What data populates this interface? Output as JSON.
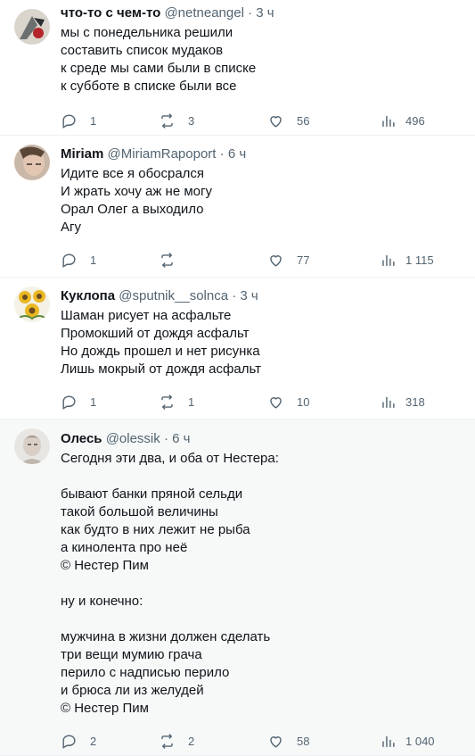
{
  "tweets": [
    {
      "name": "что-то с чем-то",
      "handle": "@netneangel",
      "time": "3 ч",
      "text": "мы с понедельника решили\nсоставить список мудаков\nк среде мы сами были в списке\nк субботе в списке были все",
      "replies": "1",
      "retweets": "3",
      "likes": "56",
      "views": "496"
    },
    {
      "name": "Miriam",
      "handle": "@MiriamRapoport",
      "time": "6 ч",
      "text": "Идите все я обосрался\nИ жрать хочу аж не могу\nОрал Олег а выходило\nАгу",
      "replies": "1",
      "retweets": "",
      "likes": "77",
      "views": "1 115"
    },
    {
      "name": "Куклопа",
      "handle": "@sputnik__solnca",
      "time": "3 ч",
      "text": "Шаман рисует на асфальте\nПромокший от дождя асфальт\nНо дождь прошел и нет рисунка\nЛишь мокрый от дождя асфальт",
      "replies": "1",
      "retweets": "1",
      "likes": "10",
      "views": "318"
    },
    {
      "name": "Олесь",
      "handle": "@olessik",
      "time": "6 ч",
      "text": "Сегодня эти два, и оба от Нестера:\n\nбывают банки пряной сельди\nтакой большой величины\nкак будто в них лежит не рыба\nа кинолента про неё\n© Нестер Пим\n\nну и конечно:\n\nмужчина в жизни должен сделать\nтри вещи мумию грача\nперило с надписью перило\nи брюса ли из желудей\n© Нестер Пим",
      "replies": "2",
      "retweets": "2",
      "likes": "58",
      "views": "1 040"
    }
  ],
  "separator": "·",
  "colors": {
    "text": "#0f1419",
    "secondary": "#536471",
    "border": "#eff3f4",
    "highlight_bg": "#f7f9f9"
  }
}
